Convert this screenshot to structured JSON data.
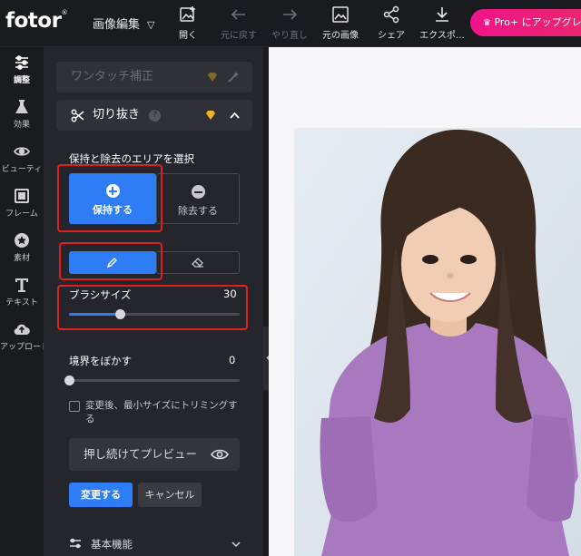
{
  "app": {
    "logo": "fotor",
    "logo_mark": "®"
  },
  "topbar": {
    "menu_label": "画像編集",
    "tools": [
      {
        "label": "開く",
        "icon": "open-image-icon",
        "enabled": true
      },
      {
        "label": "元に戻す",
        "icon": "undo-arrow-icon",
        "enabled": false
      },
      {
        "label": "やり直し",
        "icon": "redo-arrow-icon",
        "enabled": false
      },
      {
        "label": "元の画像",
        "icon": "original-image-icon",
        "enabled": true
      },
      {
        "label": "シェア",
        "icon": "share-icon",
        "enabled": true
      },
      {
        "label": "エクスポ…",
        "icon": "download-icon",
        "enabled": true
      }
    ],
    "pro_button": "Pro+ にアップグレードす"
  },
  "left_nav": [
    {
      "label": "調整",
      "icon": "sliders-icon",
      "active": true
    },
    {
      "label": "効果",
      "icon": "flask-icon",
      "active": false
    },
    {
      "label": "ビューティ",
      "icon": "eye-icon",
      "active": false
    },
    {
      "label": "フレーム",
      "icon": "frame-icon",
      "active": false
    },
    {
      "label": "素材",
      "icon": "star-icon",
      "active": false
    },
    {
      "label": "テキスト",
      "icon": "text-t-icon",
      "active": false
    },
    {
      "label": "アップロード",
      "icon": "cloud-upload-icon",
      "active": false
    }
  ],
  "panel": {
    "quick_fix": "ワンタッチ補正",
    "crop_title": "切り抜き",
    "area_label": "保持と除去のエリアを選択",
    "keep_label": "保持する",
    "remove_label": "除去する",
    "brush_size_label": "ブラシサイズ",
    "brush_size_value": "30",
    "brush_size_fraction": 0.3,
    "feather_label": "境界をぼかす",
    "feather_value": "0",
    "feather_fraction": 0,
    "trim_checkbox": "変更後、最小サイズにトリミングする",
    "trim_checked": false,
    "preview_label": "押し続けてプレビュー",
    "apply_label": "変更する",
    "cancel_label": "キャンセル",
    "basic_label": "基本機能"
  },
  "colors": {
    "accent": "#2f7df6",
    "pro_pink": "#f0148a",
    "gem": "#f0b429",
    "highlight": "#e02020",
    "top": "#1a1b1f",
    "panel": "#25262b"
  }
}
